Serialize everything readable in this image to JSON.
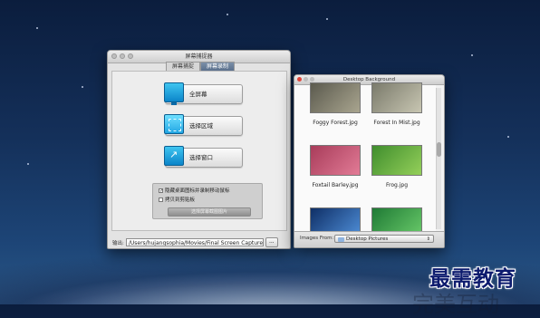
{
  "capture_window": {
    "title": "屏幕捕捉器",
    "tabs": [
      {
        "label": "屏幕捕捉",
        "active": false
      },
      {
        "label": "屏幕录制",
        "active": true
      }
    ],
    "buttons": [
      {
        "label": "全屏幕",
        "icon": "monitor-icon"
      },
      {
        "label": "选择区域",
        "icon": "region-icon"
      },
      {
        "label": "选择窗口",
        "icon": "window-icon"
      }
    ],
    "options": [
      {
        "label": "隐藏桌面图标并录制移动鼠标",
        "checked": true
      },
      {
        "label": "拷贝到剪贴板",
        "checked": false
      }
    ],
    "save_button": "选择屏幕截图图片",
    "output_label": "输出:",
    "output_path": "/Users/hujangsophia/Movies/Final Screen Capture",
    "browse_label": "..."
  },
  "background_window": {
    "title": "Desktop Background",
    "images": [
      {
        "caption": "Foggy Forest.jpg",
        "colors": [
          "#5b5a4e",
          "#a9a58f"
        ]
      },
      {
        "caption": "Forest In Mist.jpg",
        "colors": [
          "#7a7a6b",
          "#c8c6b2"
        ]
      },
      {
        "caption": "Foxtail Barley.jpg",
        "colors": [
          "#a83c5a",
          "#e27b96"
        ]
      },
      {
        "caption": "Frog.jpg",
        "colors": [
          "#3f8d2d",
          "#95d05a"
        ]
      },
      {
        "caption": "",
        "colors": [
          "#0f2f66",
          "#4f8fd9"
        ]
      },
      {
        "caption": "",
        "colors": [
          "#1f7a35",
          "#6acb6a"
        ]
      }
    ],
    "footer_label": "Images From:",
    "footer_value": "Desktop Pictures"
  },
  "watermark": {
    "line1": "最需教育",
    "line2": "完美互动"
  }
}
